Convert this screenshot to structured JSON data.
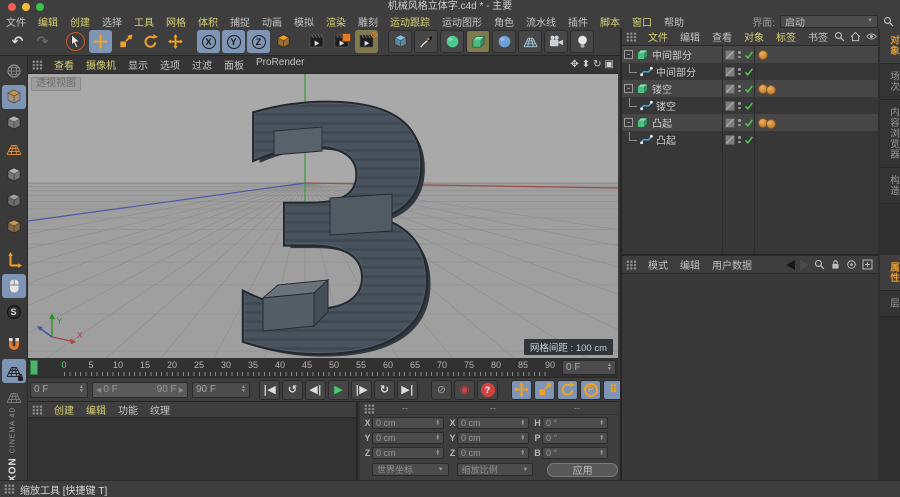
{
  "window": {
    "title": "机械风格立体字.c4d * - 主要"
  },
  "menubar": {
    "items": [
      {
        "label": "文件",
        "highlight": false
      },
      {
        "label": "编辑",
        "highlight": true
      },
      {
        "label": "创建",
        "highlight": true
      },
      {
        "label": "选择",
        "highlight": false
      },
      {
        "label": "工具",
        "highlight": true
      },
      {
        "label": "网格",
        "highlight": true
      },
      {
        "label": "体积",
        "highlight": true
      },
      {
        "label": "捕捉",
        "highlight": false
      },
      {
        "label": "动画",
        "highlight": false
      },
      {
        "label": "模拟",
        "highlight": false
      },
      {
        "label": "渲染",
        "highlight": true
      },
      {
        "label": "雕刻",
        "highlight": false
      },
      {
        "label": "运动跟踪",
        "highlight": true
      },
      {
        "label": "运动图形",
        "highlight": false
      },
      {
        "label": "角色",
        "highlight": false
      },
      {
        "label": "流水线",
        "highlight": false
      },
      {
        "label": "插件",
        "highlight": false
      },
      {
        "label": "脚本",
        "highlight": true
      },
      {
        "label": "窗口",
        "highlight": true
      },
      {
        "label": "帮助",
        "highlight": false
      }
    ],
    "interface_label": "界面:",
    "interface_value": "启动"
  },
  "main_toolbar": {
    "buttons": [
      {
        "name": "undo",
        "glyph": "↶",
        "color": "#dcdcdc"
      },
      {
        "name": "redo",
        "glyph": "↷",
        "color": "#676767"
      },
      {
        "name": "live-selection",
        "icon": "cursor",
        "color": "#e8e8e8",
        "ring": true,
        "sep": true
      },
      {
        "name": "move-tool",
        "icon": "move",
        "color": "#f0a228",
        "bg": "#7e95b5"
      },
      {
        "name": "scale-tool",
        "icon": "scale",
        "color": "#f0a228"
      },
      {
        "name": "rotate-tool",
        "icon": "rotate",
        "color": "#f0a228"
      },
      {
        "name": "last-used-tool",
        "icon": "move",
        "color": "#f0a228"
      },
      {
        "name": "lock-x-axis",
        "letter": "X",
        "bg": "#7e95b5",
        "sep": true
      },
      {
        "name": "lock-y-axis",
        "letter": "Y",
        "bg": "#7e95b5"
      },
      {
        "name": "lock-z-axis",
        "letter": "Z",
        "bg": "#7e95b5"
      },
      {
        "name": "coordinate-system",
        "icon": "cube",
        "color": "#f0a228"
      },
      {
        "name": "render-view",
        "icon": "clapper",
        "sep": true
      },
      {
        "name": "render-region",
        "icon": "clapper",
        "badge": "square"
      },
      {
        "name": "render-settings",
        "icon": "clapper",
        "badge": "gear",
        "bg": "#807a4e"
      },
      {
        "name": "add-primitive-cube",
        "icon": "cube",
        "color": "#7fc4ea",
        "raised": true,
        "sep": true
      },
      {
        "name": "pen-spline",
        "icon": "pen",
        "color": "#e0e0e0",
        "raised": true
      },
      {
        "name": "subdivision-surface",
        "icon": "sphere",
        "color": "#4ec98e",
        "raised": true
      },
      {
        "name": "generators-extrude",
        "icon": "extrude",
        "bg": "#807a4e",
        "raised": true
      },
      {
        "name": "deformers",
        "icon": "sphere",
        "color": "#6f9fd8",
        "raised": true
      },
      {
        "name": "environment-floor",
        "icon": "grid3d",
        "color": "#a9cce4",
        "raised": true
      },
      {
        "name": "camera",
        "icon": "camera",
        "color": "#cdd2d8",
        "raised": true
      },
      {
        "name": "light",
        "icon": "bulb",
        "color": "#e8e8e8",
        "raised": true
      }
    ]
  },
  "left_toolbar": {
    "buttons": [
      {
        "name": "make-editable",
        "icon": "globe",
        "color": "#8a8a8a"
      },
      {
        "name": "model-mode",
        "icon": "cube",
        "color": "#c9934a",
        "bg": "#7e95b5"
      },
      {
        "name": "texture-mode",
        "icon": "cube",
        "color": "#b5b5b5"
      },
      {
        "name": "uv-edit-mode",
        "icon": "grid3d",
        "color": "#e08a2e"
      },
      {
        "name": "points-mode",
        "icon": "cube",
        "color": "#b5b5b5"
      },
      {
        "name": "edges-mode",
        "icon": "cube",
        "color": "#a0a0a0"
      },
      {
        "name": "polygons-mode",
        "icon": "cube",
        "color": "#c89a5a"
      },
      {
        "name": "axis-mode",
        "icon": "axis",
        "color": "#f0a228",
        "sep": true
      },
      {
        "name": "viewport-interaction",
        "icon": "mouse",
        "color": "#e5e5e5",
        "bg": "#7e95b5"
      },
      {
        "name": "soft-selection",
        "letter": "S",
        "dark": true
      },
      {
        "name": "snap",
        "icon": "magnet",
        "color": "#e07b2a",
        "sep": true
      },
      {
        "name": "lock-workplane",
        "icon": "grid3d",
        "color": "#232323",
        "bg": "#7e95b5",
        "overlay": "lock"
      },
      {
        "name": "workplane",
        "icon": "grid3d",
        "color": "#7a7a7a"
      }
    ],
    "brand_maxon": "MAXON",
    "brand_cinema": "CINEMA 4D"
  },
  "viewport": {
    "menu": [
      {
        "label": "查看",
        "highlight": true
      },
      {
        "label": "摄像机",
        "highlight": true
      },
      {
        "label": "显示",
        "highlight": false
      },
      {
        "label": "选项",
        "highlight": false
      },
      {
        "label": "过滤",
        "highlight": false
      },
      {
        "label": "面板",
        "highlight": false
      },
      {
        "label": "ProRender",
        "highlight": false
      }
    ],
    "corner_icons": [
      "pan-icon",
      "zoom-icon",
      "rotate-view-icon",
      "maximize-icon"
    ],
    "view_label": "透视视图",
    "grid_spacing_label": "网格间距 : 100 cm",
    "axis_x_label": "X",
    "axis_y_label": "Y"
  },
  "timeline": {
    "labels": [
      "0",
      "5",
      "10",
      "15",
      "20",
      "25",
      "30",
      "35",
      "40",
      "45",
      "50",
      "55",
      "60",
      "65",
      "70",
      "75",
      "80",
      "85",
      "90"
    ],
    "ruler_frame": "0 F",
    "current_frame": "0 F",
    "range_start": "0 F",
    "range_end": "90 F",
    "end_frame": "90 F"
  },
  "transport": {
    "buttons": [
      {
        "name": "goto-start",
        "glyph": "|◀"
      },
      {
        "name": "play-reverse",
        "glyph": "↺"
      },
      {
        "name": "prev-frame",
        "glyph": "◀|"
      },
      {
        "name": "play-forward",
        "glyph": "▶",
        "color": "#46d070"
      },
      {
        "name": "next-frame",
        "glyph": "|▶"
      },
      {
        "name": "play-loop",
        "glyph": "↻"
      },
      {
        "name": "goto-end",
        "glyph": "▶|"
      },
      {
        "name": "record-off",
        "glyph": "⊘",
        "color": "#8a8a8a",
        "gap": true
      },
      {
        "name": "record-keyframe",
        "glyph": "◉",
        "color": "#cf4343"
      },
      {
        "name": "autokey",
        "circle": "?"
      },
      {
        "name": "key-position",
        "icon": "move",
        "color": "#f0a228",
        "bg": "#7e95b5",
        "gap": true
      },
      {
        "name": "key-scale",
        "icon": "scale",
        "color": "#f0a228",
        "bg": "#7e95b5"
      },
      {
        "name": "key-rotation",
        "icon": "rotate",
        "color": "#f0a228",
        "bg": "#7e95b5"
      },
      {
        "name": "key-parameter",
        "ring_letter": "P",
        "bg": "#7e95b5"
      },
      {
        "name": "key-pla",
        "glyph": "⠿",
        "color": "#f0a228",
        "bg": "#7e95b5"
      },
      {
        "name": "motion-system",
        "icon": "film",
        "gap": true
      }
    ]
  },
  "materials": {
    "menu": [
      {
        "label": "创建",
        "highlight": true
      },
      {
        "label": "编辑",
        "highlight": true
      },
      {
        "label": "功能",
        "highlight": false
      },
      {
        "label": "纹理",
        "highlight": false
      }
    ]
  },
  "coordinates": {
    "headers": [
      "--",
      "--",
      "--"
    ],
    "rows": [
      {
        "c1": "X",
        "v1": "0 cm",
        "c2": "X",
        "v2": "0 cm",
        "c3": "H",
        "v3": "0 °"
      },
      {
        "c1": "Y",
        "v1": "0 cm",
        "c2": "Y",
        "v2": "0 cm",
        "c3": "P",
        "v3": "0 °"
      },
      {
        "c1": "Z",
        "v1": "0 cm",
        "c2": "Z",
        "v2": "0 cm",
        "c3": "B",
        "v3": "0 °"
      }
    ],
    "transform_mode": "世界坐标",
    "scale_mode": "缩放比例",
    "apply_label": "应用"
  },
  "object_manager": {
    "menu": [
      {
        "label": "文件",
        "highlight": true
      },
      {
        "label": "编辑",
        "highlight": false
      },
      {
        "label": "查看",
        "highlight": false
      },
      {
        "label": "对象",
        "highlight": true
      },
      {
        "label": "标签",
        "highlight": true
      },
      {
        "label": "书签",
        "highlight": false
      }
    ],
    "header_icons": [
      "magnifier",
      "home",
      "eye",
      "plusbox"
    ],
    "rows": [
      {
        "label": "中间部分",
        "type": "extrude-object",
        "child": false,
        "tags": 1
      },
      {
        "label": "中间部分",
        "type": "spline",
        "child": true,
        "tags": 0
      },
      {
        "label": "镂空",
        "type": "extrude-object",
        "child": false,
        "tags": 2
      },
      {
        "label": "镂空",
        "type": "spline",
        "child": true,
        "tags": 0
      },
      {
        "label": "凸起",
        "type": "extrude-object",
        "child": false,
        "tags": 2
      },
      {
        "label": "凸起",
        "type": "spline",
        "child": true,
        "tags": 0
      }
    ],
    "side_tabs": [
      {
        "label": "对象",
        "active": true
      },
      {
        "label": "场次",
        "active": false
      },
      {
        "label": "内容浏览器",
        "active": false
      },
      {
        "label": "构造",
        "active": false
      }
    ]
  },
  "attribute_manager": {
    "menu": [
      {
        "label": "模式",
        "highlight": false
      },
      {
        "label": "编辑",
        "highlight": false
      },
      {
        "label": "用户数据",
        "highlight": false
      }
    ],
    "header_icons": [
      "back",
      "forward",
      "magnifier",
      "lock",
      "target",
      "plusbox"
    ],
    "side_tabs": [
      {
        "label": "属性",
        "active": true
      },
      {
        "label": "层",
        "active": false
      }
    ]
  },
  "statusbar": {
    "tool_hint": "缩放工具 [快捷键 T]"
  }
}
